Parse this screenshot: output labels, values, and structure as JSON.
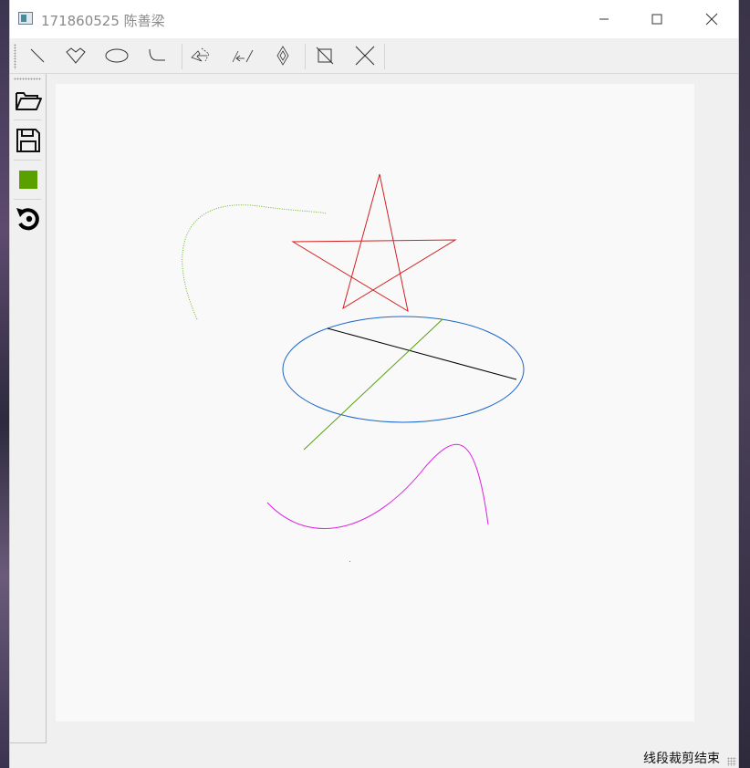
{
  "window": {
    "title": "171860525 陈善梁",
    "controls": {
      "minimize": "minimize-icon",
      "maximize": "maximize-icon",
      "close": "close-icon"
    }
  },
  "toolbar": {
    "tools": [
      {
        "name": "line-tool",
        "icon": "line-icon"
      },
      {
        "name": "polygon-tool",
        "icon": "polygon-icon"
      },
      {
        "name": "ellipse-tool",
        "icon": "ellipse-icon"
      },
      {
        "name": "curve-tool",
        "icon": "curve-icon"
      },
      {
        "name": "translate-tool",
        "icon": "translate-icon"
      },
      {
        "name": "rotate-tool",
        "icon": "rotate-icon"
      },
      {
        "name": "scale-tool",
        "icon": "scale-icon"
      },
      {
        "name": "clip-tool",
        "icon": "clip-icon"
      },
      {
        "name": "delete-tool",
        "icon": "delete-icon"
      }
    ]
  },
  "sidebar": {
    "items": [
      {
        "name": "open-file",
        "icon": "folder-open-icon"
      },
      {
        "name": "save-file",
        "icon": "save-icon"
      },
      {
        "name": "color-picker",
        "icon": "color-swatch-icon",
        "color": "#5aa000"
      },
      {
        "name": "reset",
        "icon": "reset-icon"
      }
    ]
  },
  "canvas": {
    "colors": {
      "star": "#d42020",
      "ellipse": "#1a66c8",
      "black_line": "#000000",
      "green_line": "#58a010",
      "magenta_curve": "#e020e0",
      "dotted_curve": "#6ab820"
    }
  },
  "status": {
    "text": "线段裁剪结束"
  }
}
